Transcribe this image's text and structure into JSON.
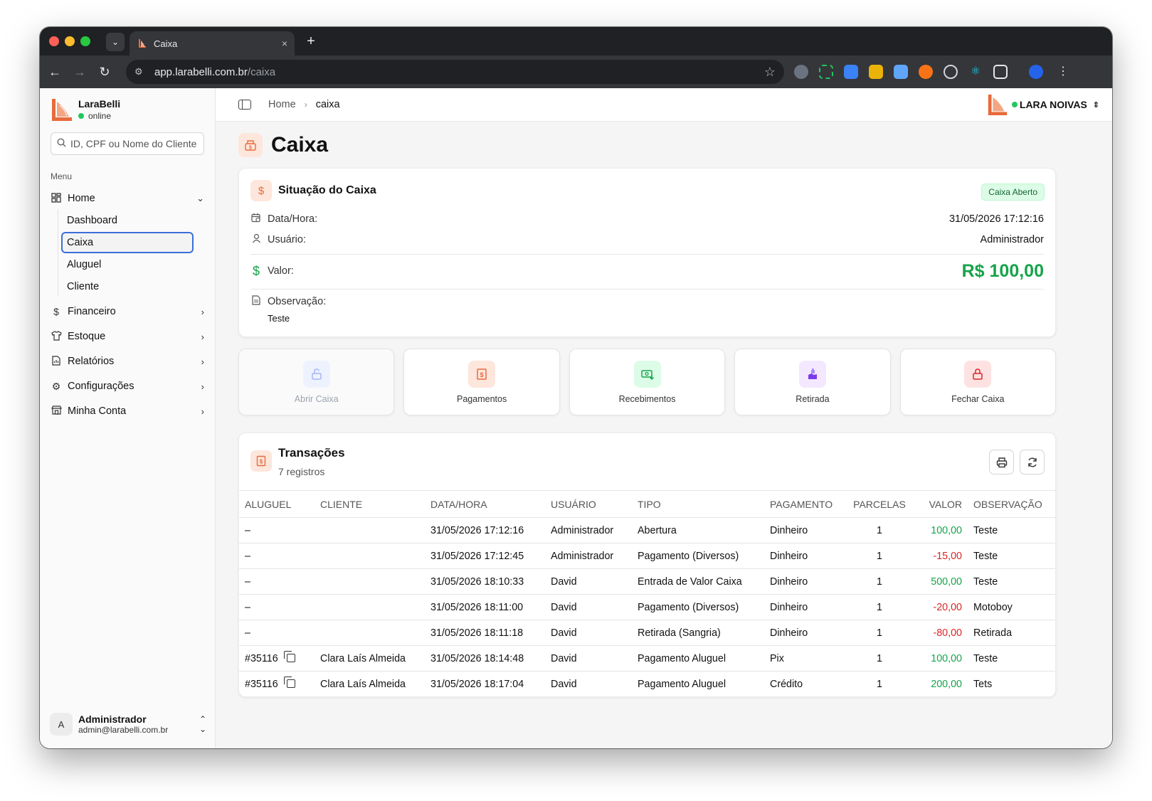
{
  "browser": {
    "tab_title": "Caixa",
    "tab_close": "×",
    "new_tab": "+",
    "url_host": "app.larabelli.com.br",
    "url_path": "/caixa"
  },
  "sidebar": {
    "brand_name": "LaraBelli",
    "brand_status": "online",
    "search_placeholder": "ID, CPF ou Nome do Cliente",
    "menu_label": "Menu",
    "home": {
      "label": "Home",
      "icon": "dashboard-grid-icon"
    },
    "home_sub": [
      {
        "label": "Dashboard"
      },
      {
        "label": "Caixa",
        "active": true
      },
      {
        "label": "Aluguel"
      },
      {
        "label": "Cliente"
      }
    ],
    "items": [
      {
        "label": "Financeiro",
        "icon": "dollar-icon"
      },
      {
        "label": "Estoque",
        "icon": "shirt-icon"
      },
      {
        "label": "Relatórios",
        "icon": "report-icon"
      },
      {
        "label": "Configurações",
        "icon": "gear-icon"
      },
      {
        "label": "Minha Conta",
        "icon": "store-icon"
      }
    ],
    "user": {
      "avatar": "A",
      "name": "Administrador",
      "email": "admin@larabelli.com.br"
    }
  },
  "topbar": {
    "breadcrumb_home": "Home",
    "breadcrumb_sep": "›",
    "breadcrumb_current": "caixa",
    "store_name": "LARA NOIVAS"
  },
  "page": {
    "title": "Caixa"
  },
  "status": {
    "title": "Situação do Caixa",
    "badge": "Caixa Aberto",
    "datetime_label": "Data/Hora:",
    "datetime_value": "31/05/2026 17:12:16",
    "user_label": "Usuário:",
    "user_value": "Administrador",
    "valor_label": "Valor:",
    "valor_value": "R$ 100,00",
    "obs_label": "Observação:",
    "obs_value": "Teste"
  },
  "actions": [
    {
      "label": "Abrir Caixa",
      "icon": "unlock-icon",
      "disabled": true
    },
    {
      "label": "Pagamentos",
      "icon": "receipt-icon"
    },
    {
      "label": "Recebimentos",
      "icon": "money-in-icon"
    },
    {
      "label": "Retirada",
      "icon": "withdraw-icon"
    },
    {
      "label": "Fechar Caixa",
      "icon": "lock-icon"
    }
  ],
  "transactions": {
    "title": "Transações",
    "count_label": "7 registros",
    "columns": [
      "ALUGUEL",
      "CLIENTE",
      "DATA/HORA",
      "USUÁRIO",
      "TIPO",
      "PAGAMENTO",
      "PARCELAS",
      "VALOR",
      "OBSERVAÇÃO"
    ],
    "rows": [
      {
        "aluguel": "–",
        "cliente": "",
        "datahora": "31/05/2026 17:12:16",
        "usuario": "Administrador",
        "tipo": "Abertura",
        "pagamento": "Dinheiro",
        "parcelas": "1",
        "valor": "100,00",
        "sign": "pos",
        "obs": "Teste"
      },
      {
        "aluguel": "–",
        "cliente": "",
        "datahora": "31/05/2026 17:12:45",
        "usuario": "Administrador",
        "tipo": "Pagamento (Diversos)",
        "pagamento": "Dinheiro",
        "parcelas": "1",
        "valor": "-15,00",
        "sign": "neg",
        "obs": "Teste"
      },
      {
        "aluguel": "–",
        "cliente": "",
        "datahora": "31/05/2026 18:10:33",
        "usuario": "David",
        "tipo": "Entrada de Valor Caixa",
        "pagamento": "Dinheiro",
        "parcelas": "1",
        "valor": "500,00",
        "sign": "pos",
        "obs": "Teste"
      },
      {
        "aluguel": "–",
        "cliente": "",
        "datahora": "31/05/2026 18:11:00",
        "usuario": "David",
        "tipo": "Pagamento (Diversos)",
        "pagamento": "Dinheiro",
        "parcelas": "1",
        "valor": "-20,00",
        "sign": "neg",
        "obs": "Motoboy"
      },
      {
        "aluguel": "–",
        "cliente": "",
        "datahora": "31/05/2026 18:11:18",
        "usuario": "David",
        "tipo": "Retirada (Sangria)",
        "pagamento": "Dinheiro",
        "parcelas": "1",
        "valor": "-80,00",
        "sign": "neg",
        "obs": "Retirada"
      },
      {
        "aluguel": "#35116",
        "copy": true,
        "cliente": "Clara Laís Almeida",
        "datahora": "31/05/2026 18:14:48",
        "usuario": "David",
        "tipo": "Pagamento Aluguel",
        "pagamento": "Pix",
        "parcelas": "1",
        "valor": "100,00",
        "sign": "pos",
        "obs": "Teste"
      },
      {
        "aluguel": "#35116",
        "copy": true,
        "cliente": "Clara Laís Almeida",
        "datahora": "31/05/2026 18:17:04",
        "usuario": "David",
        "tipo": "Pagamento Aluguel",
        "pagamento": "Crédito",
        "parcelas": "1",
        "valor": "200,00",
        "sign": "pos",
        "obs": "Tets"
      }
    ]
  },
  "colors": {
    "accent_orange": "#e86a3b",
    "green": "#16a34a",
    "red": "#dc2626",
    "active_border": "#3b6fd8"
  }
}
